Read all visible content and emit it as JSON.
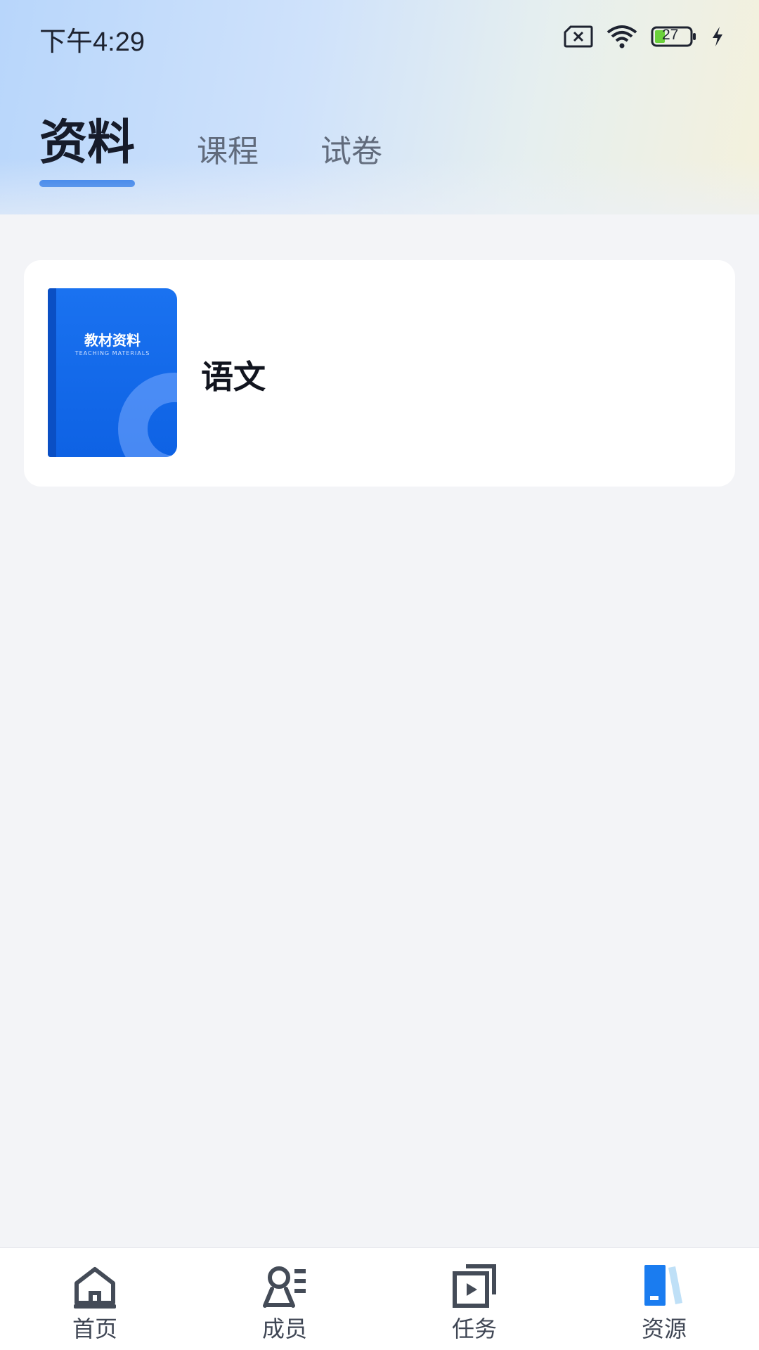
{
  "status_bar": {
    "time": "下午4:29",
    "battery": "27"
  },
  "tabs": [
    {
      "label": "资料",
      "active": true
    },
    {
      "label": "课程",
      "active": false
    },
    {
      "label": "试卷",
      "active": false
    }
  ],
  "materials": [
    {
      "title": "语文",
      "cover": {
        "title": "教材资料",
        "subtitle": "TEACHING MATERIALS"
      }
    }
  ],
  "bottom_nav": [
    {
      "label": "首页",
      "icon": "home-icon"
    },
    {
      "label": "成员",
      "icon": "members-icon"
    },
    {
      "label": "任务",
      "icon": "tasks-icon"
    },
    {
      "label": "资源",
      "icon": "resources-icon",
      "active": true
    }
  ],
  "colors": {
    "accent": "#1a6ee8",
    "background": "#f3f4f7"
  }
}
